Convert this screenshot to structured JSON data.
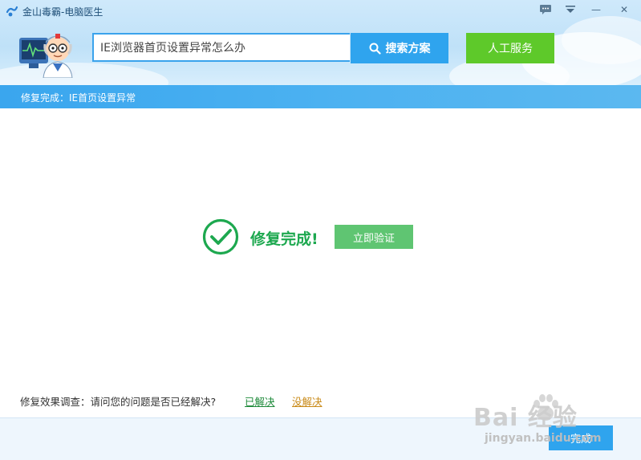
{
  "app": {
    "title": "金山毒霸-电脑医生"
  },
  "window_controls": {
    "chat_icon": "chat-bubble-icon",
    "menu_icon": "dropdown-menu-icon",
    "min_label": "—",
    "close_label": "✕"
  },
  "search": {
    "value": "IE浏览器首页设置异常怎么办",
    "button_label": "搜索方案",
    "icon": "search-icon"
  },
  "service": {
    "button_label": "人工服务"
  },
  "status": {
    "text": "修复完成：IE首页设置异常"
  },
  "result": {
    "title": "修复完成!",
    "verify_label": "立即验证",
    "icon": "check-circle-icon"
  },
  "survey": {
    "question": "修复效果调查：请问您的问题是否已经解决?",
    "solved_label": "已解决",
    "unsolved_label": "没解决"
  },
  "footer": {
    "finish_label": "完成"
  },
  "watermark": {
    "brand": "Bai  经验",
    "url": "jingyan.baidu.com"
  },
  "colors": {
    "accent_blue": "#2fa4ee",
    "accent_green": "#5ec92a",
    "success_green": "#1da84f"
  }
}
